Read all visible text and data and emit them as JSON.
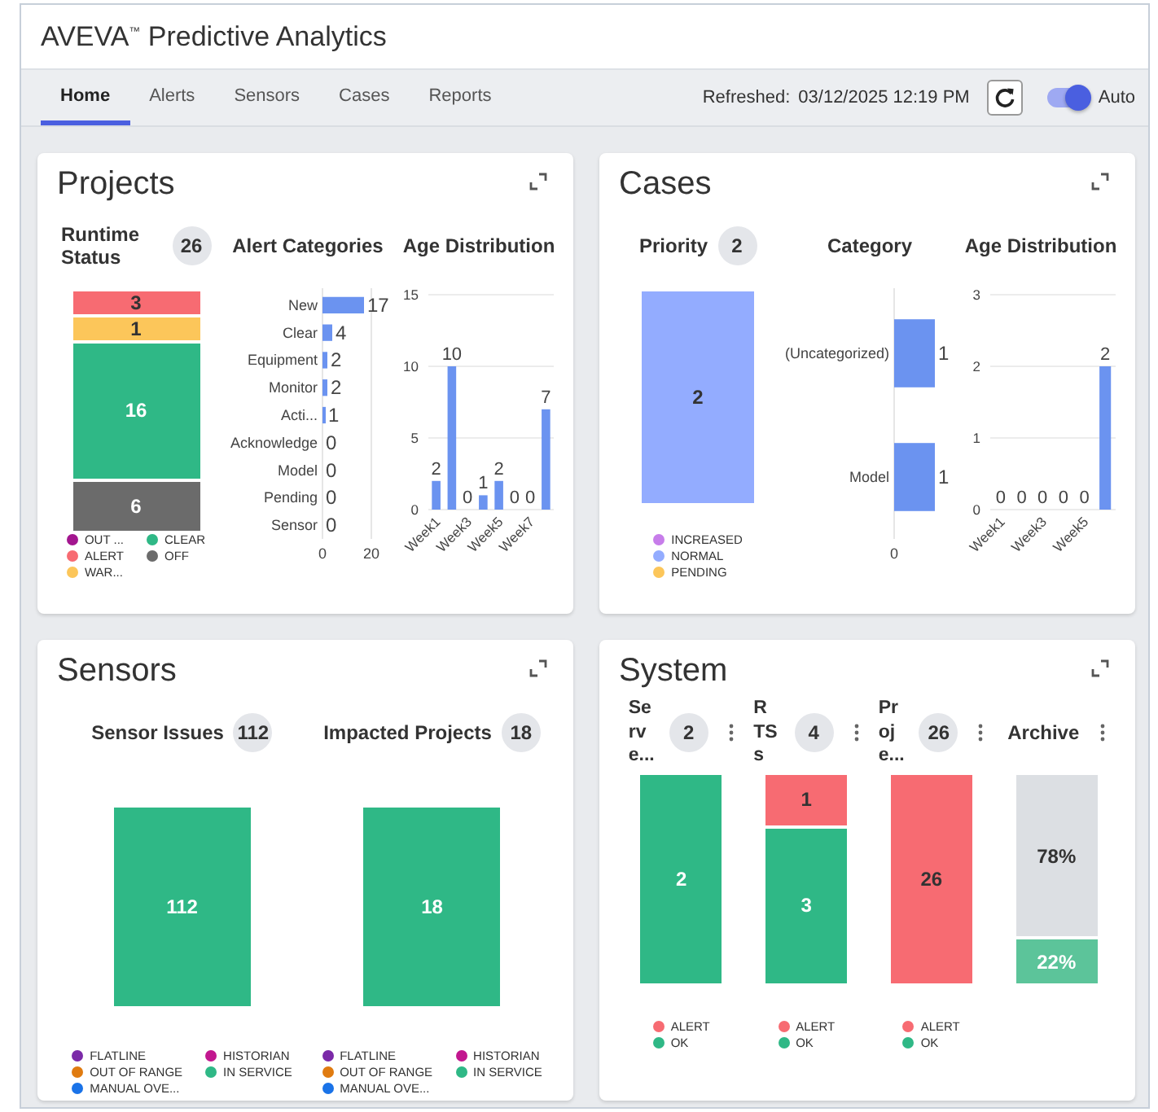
{
  "app": {
    "title": "AVEVA$^{™}$ Predictive Analytics"
  },
  "tabs": [
    {
      "label": "Home",
      "selected": true
    },
    {
      "label": "Alerts",
      "selected": false
    },
    {
      "label": "Sensors",
      "selected": false
    },
    {
      "label": "Cases",
      "selected": false
    },
    {
      "label": "Reports",
      "selected": false
    }
  ],
  "refresh": {
    "label": "Refreshed:",
    "time": "03/12/2025 12:19 PM"
  },
  "auto_toggle": {
    "label": "Auto",
    "on": true
  },
  "cards": [
    {
      "title": "Projects",
      "panels": [
        {
          "kind": "stack",
          "title": "Runtime Status",
          "count": "26",
          "segments": [
            {
              "label": "3",
              "color": "#f76b72"
            },
            {
              "label": "1",
              "color": "#fcc65a"
            },
            {
              "label": "16",
              "color": "#2fb886"
            },
            {
              "label": "6",
              "color": "#6b6b6b"
            }
          ],
          "legend": [
            {
              "name": "OUT ...",
              "color": "#a3168f"
            },
            {
              "name": "ALERT",
              "color": "#f76b72"
            },
            {
              "name": "WAR...",
              "color": "#fcc65a"
            },
            {
              "name": "CLEAR",
              "color": "#2fb886"
            },
            {
              "name": "OFF",
              "color": "#6b6b6b"
            }
          ]
        },
        {
          "kind": "hbar",
          "chart_data": {
            "type": "bar",
            "orientation": "horizontal",
            "title": "Alert Categories",
            "categories": [
              "New",
              "Clear",
              "Equipment",
              "Monitor",
              "Acti...",
              "Acknowledge",
              "Model",
              "Pending",
              "Sensor"
            ],
            "values": [
              17,
              4,
              2,
              2,
              1,
              0,
              0,
              0,
              0
            ],
            "xlim": [
              0,
              20
            ],
            "xticks": [
              0,
              20
            ],
            "data_labels": true
          }
        },
        {
          "kind": "column",
          "chart_data": {
            "type": "bar",
            "title": "Age Distribution",
            "categories": [
              "Week1",
              null,
              "Week3",
              null,
              "Week5",
              null,
              "Week7",
              null
            ],
            "values": [
              2,
              10,
              0,
              1,
              2,
              0,
              0,
              7
            ],
            "ylim": [
              0,
              15
            ],
            "yticks": [
              0,
              5,
              10,
              15
            ],
            "data_labels": true
          }
        }
      ]
    },
    {
      "title": "Cases",
      "panels": [
        {
          "kind": "stack",
          "title": "Priority",
          "count": "2",
          "segments": [
            {
              "label": "2",
              "color": "#93acff"
            }
          ],
          "legend": [
            {
              "name": "INCREASED",
              "color": "#c77dea"
            },
            {
              "name": "NORMAL",
              "color": "#93acff"
            },
            {
              "name": "PENDING",
              "color": "#fcc65a"
            }
          ]
        },
        {
          "kind": "hbar",
          "chart_data": {
            "type": "bar",
            "orientation": "horizontal",
            "title": "Category",
            "categories": [
              "(Uncategorized)",
              "Model"
            ],
            "values": [
              1,
              1
            ],
            "annotations": [
              "0"
            ],
            "data_labels": true
          }
        },
        {
          "kind": "column",
          "chart_data": {
            "type": "bar",
            "title": "Age Distribution",
            "categories": [
              "Week1",
              null,
              "Week3",
              null,
              "Week5",
              null
            ],
            "values": [
              0,
              0,
              0,
              0,
              0,
              2
            ],
            "ylim": [
              0,
              3
            ],
            "yticks": [
              0,
              1,
              2,
              3
            ],
            "data_labels": true
          }
        }
      ]
    },
    {
      "title": "Sensors",
      "panels": [
        {
          "kind": "stack",
          "title": "Sensor Issues",
          "count": "112",
          "segments": [
            {
              "label": "112",
              "color": "#2fb886"
            }
          ],
          "legend": [
            {
              "name": "FLATLINE",
              "color": "#7b2aa8"
            },
            {
              "name": "OUT OF RANGE",
              "color": "#e07b10"
            },
            {
              "name": "MANUAL OVE...",
              "color": "#1a73e8"
            },
            {
              "name": "HISTORIAN",
              "color": "#c2178f"
            },
            {
              "name": "IN SERVICE",
              "color": "#2fb886"
            }
          ]
        },
        {
          "kind": "stack",
          "title": "Impacted Projects",
          "count": "18",
          "segments": [
            {
              "label": "18",
              "color": "#2fb886"
            }
          ],
          "legend": [
            {
              "name": "FLATLINE",
              "color": "#7b2aa8"
            },
            {
              "name": "OUT OF RANGE",
              "color": "#e07b10"
            },
            {
              "name": "MANUAL OVE...",
              "color": "#1a73e8"
            },
            {
              "name": "HISTORIAN",
              "color": "#c2178f"
            },
            {
              "name": "IN SERVICE",
              "color": "#2fb886"
            }
          ]
        }
      ]
    },
    {
      "title": "System",
      "panels": [
        {
          "kind": "stack",
          "title": "Serve...",
          "count": "2",
          "menu": true,
          "segments": [
            {
              "label": "2",
              "color": "#2fb886"
            }
          ],
          "legend": [
            {
              "name": "ALERT",
              "color": "#f76b72"
            },
            {
              "name": "OK",
              "color": "#2fb886"
            }
          ]
        },
        {
          "kind": "stack",
          "title": "RTSs",
          "count": "4",
          "menu": true,
          "segments": [
            {
              "label": "1",
              "color": "#f76b72"
            },
            {
              "label": "3",
              "color": "#2fb886"
            }
          ],
          "legend": [
            {
              "name": "ALERT",
              "color": "#f76b72"
            },
            {
              "name": "OK",
              "color": "#2fb886"
            }
          ]
        },
        {
          "kind": "stack",
          "title": "Proje...",
          "count": "26",
          "menu": true,
          "segments": [
            {
              "label": "26",
              "color": "#f76b72"
            }
          ],
          "legend": [
            {
              "name": "ALERT",
              "color": "#f76b72"
            },
            {
              "name": "OK",
              "color": "#2fb886"
            }
          ]
        },
        {
          "kind": "stack",
          "title": "Archive",
          "menu": true,
          "segments": [
            {
              "label": "78%",
              "color": "#dcdfe3"
            },
            {
              "label": "22%",
              "color": "#5cc49a"
            }
          ]
        }
      ]
    }
  ]
}
